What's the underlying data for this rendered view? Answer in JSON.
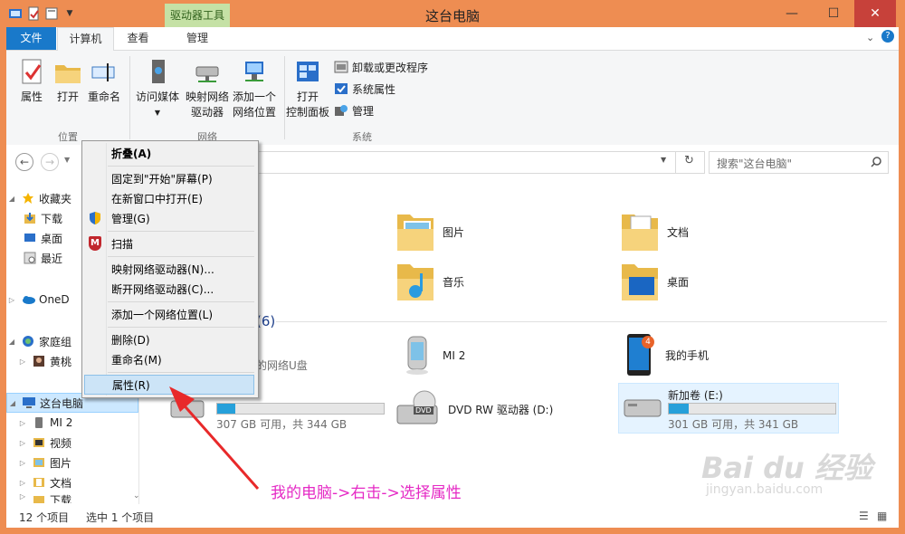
{
  "window": {
    "title": "这台电脑",
    "context_tab_group": "驱动器工具",
    "controls": {
      "minimize": "—",
      "maximize": "☐",
      "close": "✕"
    }
  },
  "ribbon_tabs": {
    "file": "文件",
    "computer": "计算机",
    "view": "查看",
    "manage": "管理"
  },
  "ribbon": {
    "location": {
      "label": "位置",
      "properties": "属性",
      "open": "打开",
      "rename": "重命名"
    },
    "network": {
      "label": "网络",
      "access_media": "访问媒体",
      "map_drive_1": "映射网络",
      "map_drive_2": "驱动器",
      "add_location_1": "添加一个",
      "add_location_2": "网络位置"
    },
    "system": {
      "label": "系统",
      "open_cp_1": "打开",
      "open_cp_2": "控制面板",
      "uninstall": "卸载或更改程序",
      "sys_props": "系统属性",
      "manage": "管理"
    }
  },
  "search": {
    "placeholder": "搜索\"这台电脑\""
  },
  "tree": {
    "favorites": "收藏夹",
    "downloads": "下载",
    "desktop": "桌面",
    "recent": "最近",
    "onedrive": "OneD",
    "homegroup": "家庭组",
    "user": "黄桃",
    "this_pc": "这台电脑",
    "mi2": "MI 2",
    "videos": "视频",
    "pictures": "图片",
    "documents": "文档",
    "downloads2": "下载"
  },
  "folders": {
    "pictures": "图片",
    "documents": "文档",
    "music": "音乐",
    "desktop": "桌面"
  },
  "devices": {
    "group_count": "(6)",
    "usb_text": "的网络U盘",
    "mi2": "MI 2",
    "my_phone": "我的手机",
    "phone_badge": "4",
    "drive_c": {
      "space": "307 GB 可用，共 344 GB",
      "used_fraction": 0.11
    },
    "dvd": "DVD RW 驱动器 (D:)",
    "dvd_badge": "DVD",
    "drive_e": {
      "name": "新加卷 (E:)",
      "space": "301 GB 可用，共 341 GB",
      "used_fraction": 0.12
    }
  },
  "status": {
    "count": "12 个项目",
    "selected": "选中 1 个项目"
  },
  "context_menu": {
    "collapse": "折叠(A)",
    "pin_start": "固定到\"开始\"屏幕(P)",
    "open_new": "在新窗口中打开(E)",
    "manage": "管理(G)",
    "scan": "扫描",
    "scan_badge": "M",
    "map_drive": "映射网络驱动器(N)...",
    "disconnect": "断开网络驱动器(C)...",
    "add_location": "添加一个网络位置(L)",
    "delete": "删除(D)",
    "rename": "重命名(M)",
    "properties": "属性(R)"
  },
  "annotation": "我的电脑->右击->选择属性",
  "watermark": {
    "logo": "Bai du 经验",
    "url": "jingyan.baidu.com"
  },
  "colors": {
    "title_bar": "#ee8d52",
    "file_tab": "#1979ca",
    "context_tab": "#c5e1a5",
    "drive_fill": "#26a0da",
    "annotation": "#e52ac5",
    "arrow": "#e8292a"
  }
}
